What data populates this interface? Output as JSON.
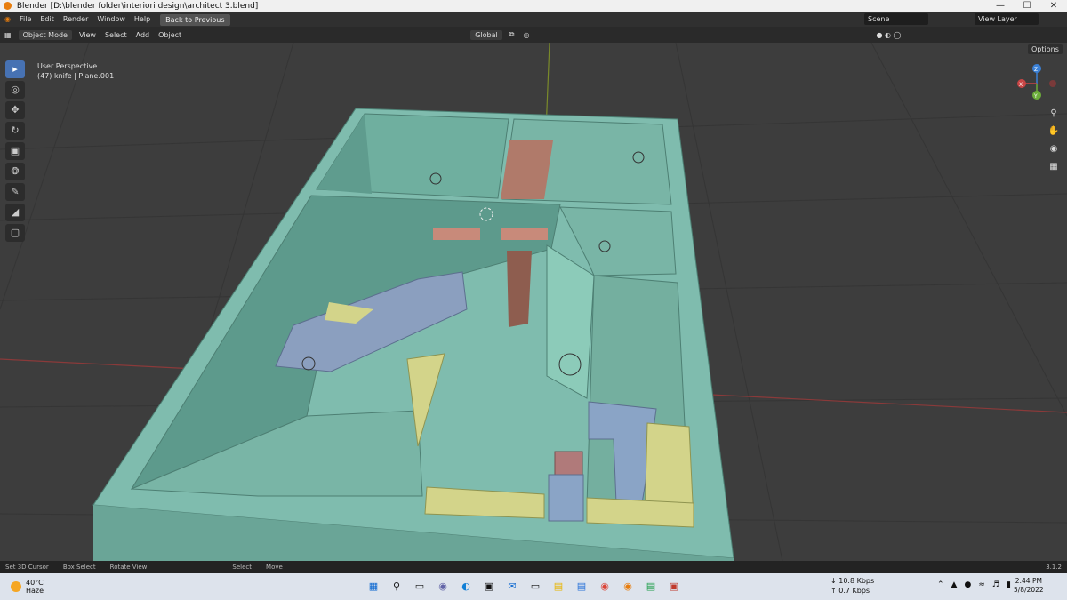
{
  "window": {
    "title": "Blender [D:\\blender folder\\interiori design\\architect 3.blend]",
    "controls": [
      "—",
      "☐",
      "✕"
    ]
  },
  "menu": {
    "items": [
      "File",
      "Edit",
      "Render",
      "Window",
      "Help"
    ],
    "back_button": "Back to Previous",
    "scene_label": "Scene",
    "view_layer_label": "View Layer"
  },
  "header3d": {
    "mode": "Object Mode",
    "menus": [
      "View",
      "Select",
      "Add",
      "Object"
    ],
    "orientation": "Global",
    "options_label": "Options"
  },
  "viewport": {
    "perspective_label": "User Perspective",
    "object_label": "(47) knife | Plane.001",
    "background_color": "#3d3d3d",
    "wall_color": "#7fbcae"
  },
  "gizmo": {
    "x": "X",
    "y": "Y",
    "z": "Z"
  },
  "toolbar": {
    "tools": [
      {
        "name": "select-box-tool",
        "glyph": "▸",
        "active": true
      },
      {
        "name": "cursor-tool",
        "glyph": "◎",
        "active": false
      },
      {
        "name": "move-tool",
        "glyph": "✥",
        "active": false
      },
      {
        "name": "rotate-tool",
        "glyph": "↻",
        "active": false
      },
      {
        "name": "scale-tool",
        "glyph": "▣",
        "active": false
      },
      {
        "name": "transform-tool",
        "glyph": "❂",
        "active": false
      },
      {
        "name": "annotate-tool",
        "glyph": "✎",
        "active": false
      },
      {
        "name": "measure-tool",
        "glyph": "◢",
        "active": false
      },
      {
        "name": "add-cube-tool",
        "glyph": "▢",
        "active": false
      }
    ]
  },
  "statusbar": {
    "items": [
      "Set 3D Cursor",
      "Box Select",
      "Rotate View",
      "Select",
      "Move"
    ],
    "version": "3.1.2"
  },
  "taskbar": {
    "temperature": "40°C",
    "weather": "Haze",
    "download": "↓ 10.8 Kbps",
    "upload": "↑ 0.7 Kbps",
    "time": "2:44 PM",
    "date": "5/8/2022"
  }
}
